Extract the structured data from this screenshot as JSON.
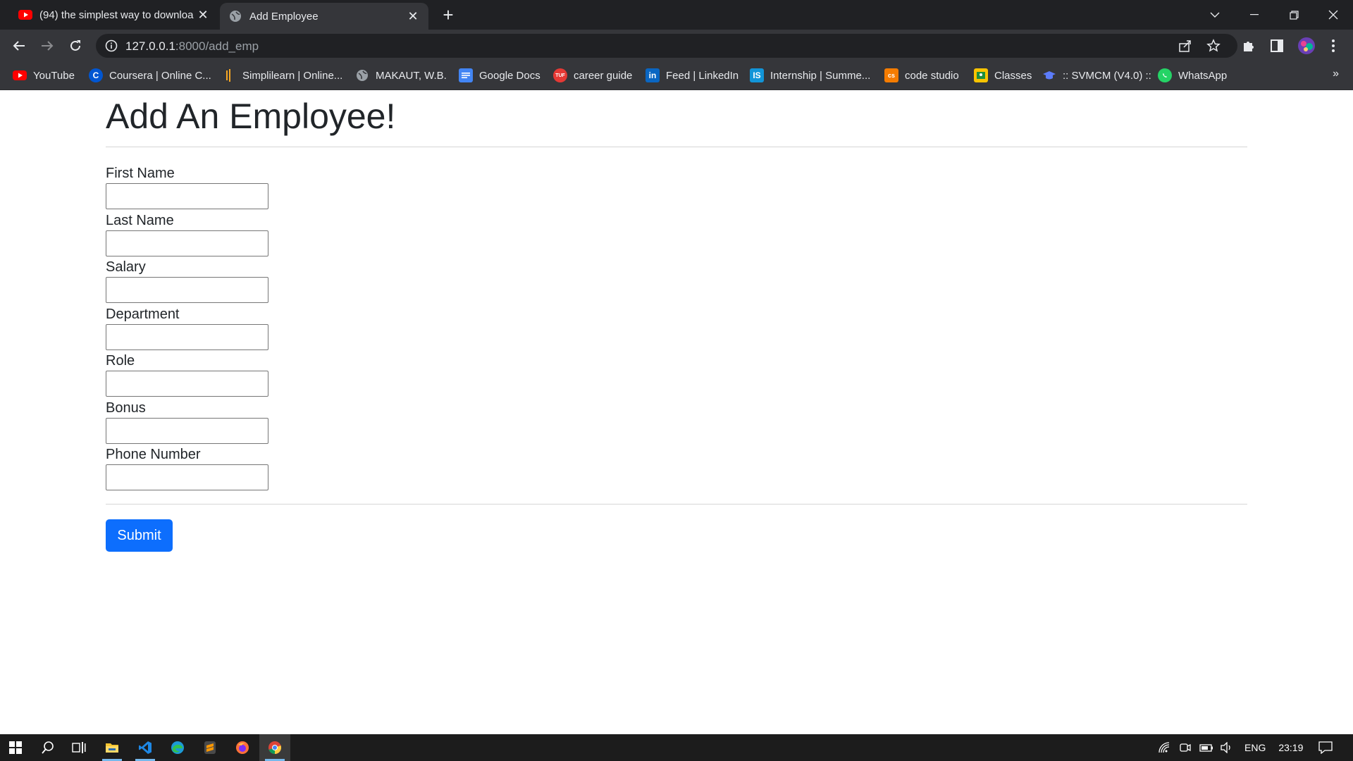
{
  "browser": {
    "tabs": [
      {
        "title": "(94) the simplest way to downloa",
        "icon": "youtube-icon"
      },
      {
        "title": "Add Employee",
        "icon": "globe-icon"
      }
    ],
    "url_host": "127.0.0.1",
    "url_path": ":8000/add_emp",
    "bookmarks": [
      {
        "label": "YouTube",
        "icon": "youtube-icon",
        "color": "#ff0000"
      },
      {
        "label": "Coursera | Online C...",
        "icon": "coursera-icon",
        "color": "#0056d2"
      },
      {
        "label": "Simplilearn | Online...",
        "icon": "simplilearn-icon",
        "color": "#f5a623"
      },
      {
        "label": "MAKAUT, W.B.",
        "icon": "globe-icon",
        "color": "#9aa0a6"
      },
      {
        "label": "Google Docs",
        "icon": "google-docs-icon",
        "color": "#4285f4"
      },
      {
        "label": "career guide",
        "icon": "tuf-icon",
        "color": "#e53935"
      },
      {
        "label": "Feed | LinkedIn",
        "icon": "linkedin-icon",
        "color": "#0a66c2"
      },
      {
        "label": "Internship | Summe...",
        "icon": "internshala-icon",
        "color": "#1295d8"
      },
      {
        "label": "code studio",
        "icon": "codestudio-icon",
        "color": "#f57c00"
      },
      {
        "label": "Classes",
        "icon": "classroom-icon",
        "color": "#f9c400"
      },
      {
        "label": ":: SVMCM (V4.0) ::",
        "icon": "graduation-cap-icon",
        "color": "#5c7cfa"
      },
      {
        "label": "WhatsApp",
        "icon": "whatsapp-icon",
        "color": "#25d366"
      }
    ]
  },
  "page": {
    "title": "Add An Employee!",
    "fields": [
      {
        "label": "First Name",
        "value": ""
      },
      {
        "label": "Last Name",
        "value": ""
      },
      {
        "label": "Salary",
        "value": ""
      },
      {
        "label": "Department",
        "value": ""
      },
      {
        "label": "Role",
        "value": ""
      },
      {
        "label": "Bonus",
        "value": ""
      },
      {
        "label": "Phone Number",
        "value": ""
      }
    ],
    "submit_label": "Submit",
    "accent_color": "#0d6efd"
  },
  "taskbar": {
    "language": "ENG",
    "time": "23:19"
  }
}
